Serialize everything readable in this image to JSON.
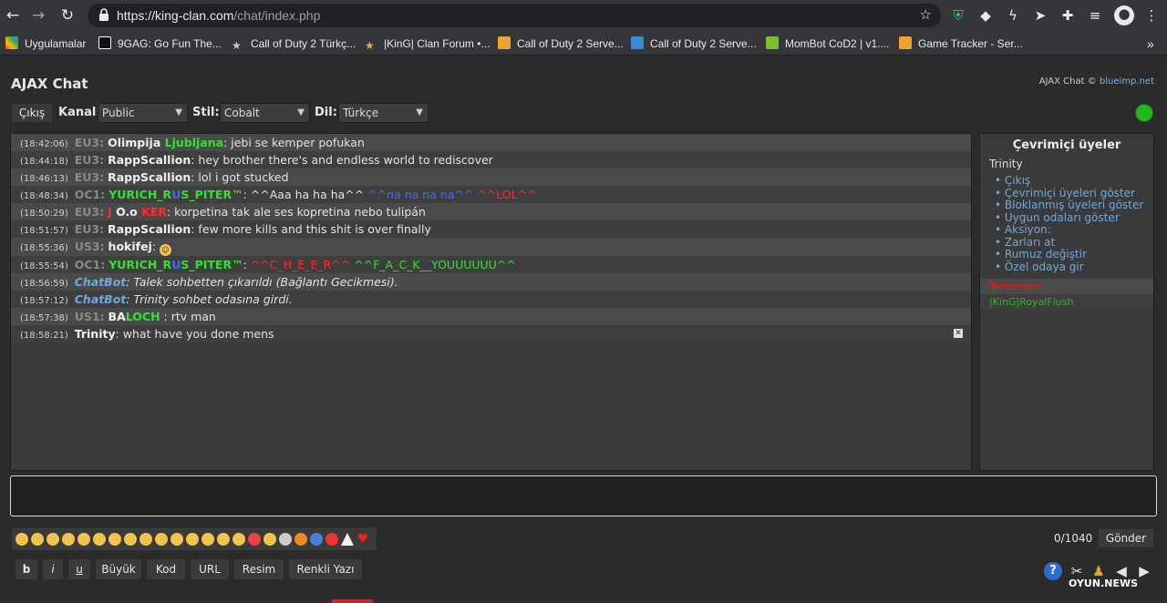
{
  "browser": {
    "url_host": "https://king-clan.com",
    "url_path": "/chat/index.php",
    "bookmarks": [
      "Uygulamalar",
      "9GAG: Go Fun The...",
      "Call of Duty 2 Türkç...",
      "|KinG| Clan Forum •...",
      "Call of Duty 2 Serve...",
      "Call of Duty 2 Serve...",
      "MomBot CoD2 | v1....",
      "Game Tracker - Ser..."
    ],
    "more_bookmarks": "»"
  },
  "app": {
    "title": "AJAX Chat",
    "copyright_prefix": "AJAX Chat ©",
    "copyright_link": "blueimp.net",
    "logout": "Çıkış",
    "channel_label": "Kanal:",
    "channel_value": "Public",
    "style_label": "Stil:",
    "style_value": "Cobalt",
    "lang_label": "Dil:",
    "lang_value": "Türkçe"
  },
  "messages": [
    {
      "time": "(18:42:06)",
      "tag": "EU3:",
      "user_a": "Olimpija ",
      "user_b": "Ljubljana",
      "text": ": jebi se kemper pofukan"
    },
    {
      "time": "(18:44:18)",
      "tag": "EU3:",
      "user": "RappScallion",
      "text": ": hey brother there's and endless world to rediscover"
    },
    {
      "time": "(18:46:13)",
      "tag": "EU3:",
      "user": "RappScallion",
      "text": ": lol i got stucked"
    },
    {
      "time": "(18:48:34)",
      "tag": "OC1:",
      "user_a": "YURICH_R",
      "user_b": "U",
      "user_c": "S_PITER™",
      "text_a": ": ^^Aaa ha ha ha^^ ",
      "text_b": "^^na na na na^^ ",
      "text_c": "^^LOL^^"
    },
    {
      "time": "(18:50:29)",
      "tag": "EU3:",
      "user_a": "J",
      "user_b": " O.o ",
      "user_c": "KER",
      "text": ": korpetina tak ale ses kopretina nebo tulipán"
    },
    {
      "time": "(18:51:57)",
      "tag": "EU3:",
      "user": "RappScallion",
      "text": ": few more kills and this shit is over finally"
    },
    {
      "time": "(18:55:36)",
      "tag": "US3:",
      "user": "hokifej",
      "text": ": "
    },
    {
      "time": "(18:55:54)",
      "tag": "OC1:",
      "user_a": "YURICH_R",
      "user_b": "U",
      "user_c": "S_PITER™",
      "text_a": ": ",
      "text_b": "^^C_H_E_E_R^^ ",
      "text_c": "^^F_A_C_K__YOUUUUUU^^"
    },
    {
      "time": "(18:56:59)",
      "user": "ChatBot",
      "text": ": Talek sohbetten çıkarıldı (Bağlantı Gecikmesi)."
    },
    {
      "time": "(18:57:12)",
      "user": "ChatBot",
      "text": ": Trinity sohbet odasına girdi."
    },
    {
      "time": "(18:57:38)",
      "tag": "US1:",
      "user_a": "BA",
      "user_b": "LOCH",
      "text": " : rtv man"
    },
    {
      "time": "(18:58:21)",
      "user": "Trinity",
      "text": ": what have you done mens"
    }
  ],
  "online": {
    "title": "Çevrimiçi üyeler",
    "me": "Trinity",
    "menu": [
      "Çıkış",
      "Çevrimiçi üyeleri göster",
      "Bloklanmış üyeleri göster",
      "Uygun odaları göster",
      "Aksiyon:",
      "Zarları at",
      "Rumuz değiştir",
      "Özel odaya gir"
    ],
    "users": [
      "Terminator",
      "|KinG|RoyalFlush"
    ]
  },
  "composer": {
    "counter": "0/1040",
    "send": "Gönder"
  },
  "bbcode": [
    "b",
    "i",
    "u",
    "Büyük",
    "Kod",
    "URL",
    "Resim",
    "Renkli Yazı"
  ],
  "watermark": "OYUN.NEWS",
  "colors": {
    "accent_link": "#6fa8dc",
    "status_online": "#1db91d",
    "nick_green": "#31e231",
    "nick_red": "#ff2a2a"
  }
}
